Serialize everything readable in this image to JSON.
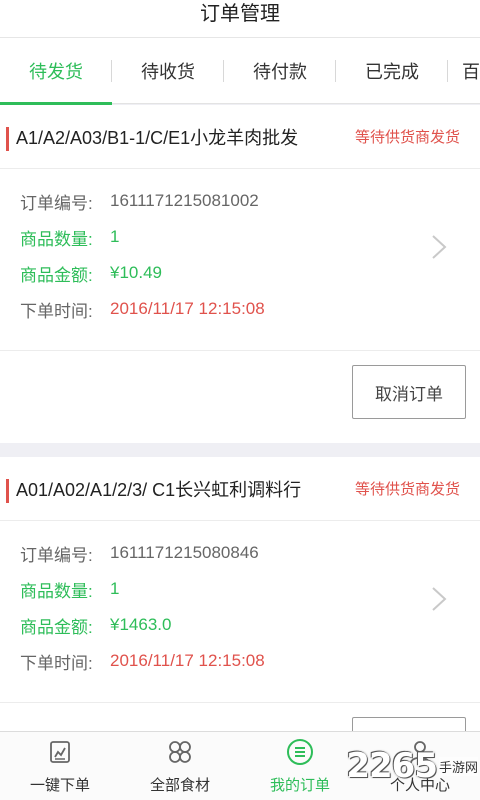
{
  "header": {
    "title": "订单管理"
  },
  "tabs": [
    {
      "label": "待发货",
      "active": true
    },
    {
      "label": "待收货",
      "active": false
    },
    {
      "label": "待付款",
      "active": false
    },
    {
      "label": "已完成",
      "active": false
    },
    {
      "label": "百",
      "active": false
    }
  ],
  "labels": {
    "order_no": "订单编号:",
    "quantity": "商品数量:",
    "amount": "商品金额:",
    "time": "下单时间:",
    "cancel": "取消订单"
  },
  "orders": [
    {
      "shop": "A1/A2/A03/B1-1/C/E1小龙羊肉批发",
      "status": "等待供货商发货",
      "order_no": "1611171215081002",
      "quantity": "1",
      "amount": "¥10.49",
      "time": "2016/11/17 12:15:08"
    },
    {
      "shop": "A01/A02/A1/2/3/ C1长兴虹利调料行",
      "status": "等待供货商发货",
      "order_no": "1611171215080846",
      "quantity": "1",
      "amount": "¥1463.0",
      "time": "2016/11/17 12:15:08"
    }
  ],
  "bottom_nav": [
    {
      "label": "一键下单",
      "icon": "quick-order-icon",
      "active": false
    },
    {
      "label": "全部食材",
      "icon": "grid-icon",
      "active": false
    },
    {
      "label": "我的订单",
      "icon": "list-icon",
      "active": true
    },
    {
      "label": "个人中心",
      "icon": "person-icon",
      "active": false
    }
  ],
  "watermark": {
    "number": "2265",
    "text": "手游网"
  },
  "colors": {
    "accent": "#2ebd59",
    "alert": "#e0524c"
  }
}
